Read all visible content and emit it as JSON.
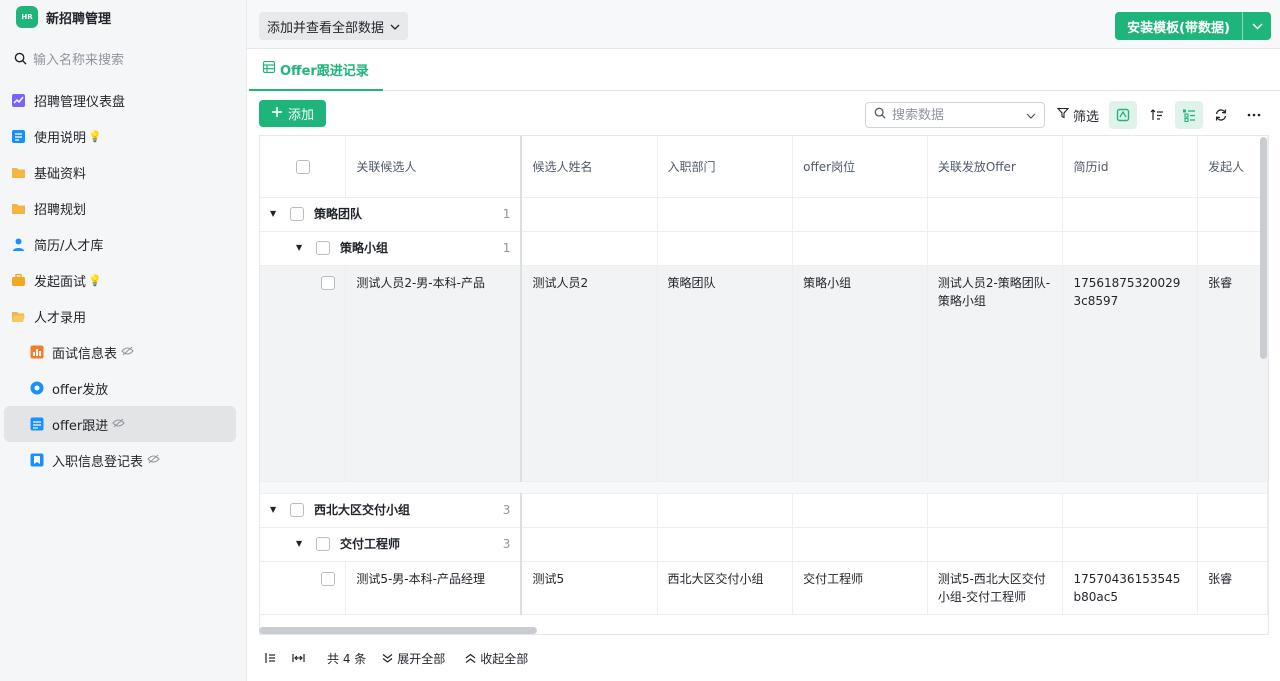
{
  "app": {
    "logo_text": "HR",
    "title": "新招聘管理"
  },
  "sidebar": {
    "search_placeholder": "输入名称来搜索",
    "items": [
      {
        "label": "招聘管理仪表盘",
        "icon": "dashboard-icon"
      },
      {
        "label": "使用说明",
        "icon": "doc-icon",
        "hint": "💡"
      },
      {
        "label": "基础资料",
        "icon": "folder-icon"
      },
      {
        "label": "招聘规划",
        "icon": "folder-icon"
      },
      {
        "label": "简历/人才库",
        "icon": "person-icon"
      },
      {
        "label": "发起面试",
        "icon": "briefcase-icon",
        "hint": "💡"
      },
      {
        "label": "人才录用",
        "icon": "folder-open-icon"
      },
      {
        "label": "面试信息表",
        "icon": "chart-icon",
        "hidden": true
      },
      {
        "label": "offer发放",
        "icon": "flow-icon"
      },
      {
        "label": "offer跟进",
        "icon": "table-icon",
        "hidden": true,
        "active": true
      },
      {
        "label": "入职信息登记表",
        "icon": "bookmark-icon",
        "hidden": true
      }
    ]
  },
  "topbar": {
    "view_all_label": "添加并查看全部数据",
    "install_label": "安装模板(带数据)"
  },
  "tab": {
    "label": "Offer跟进记录"
  },
  "toolbar": {
    "add_label": "添加",
    "search_placeholder": "搜索数据",
    "filter_label": "筛选"
  },
  "table": {
    "columns": [
      "关联候选人",
      "候选人姓名",
      "入职部门",
      "offer岗位",
      "关联发放Offer",
      "简历id",
      "发起人"
    ],
    "groups": [
      {
        "name": "策略团队",
        "count": "1",
        "subgroups": [
          {
            "name": "策略小组",
            "count": "1",
            "rows": [
              {
                "candidate": "测试人员2-男-本科-产品",
                "name": "测试人员2",
                "dept": "策略团队",
                "position": "策略小组",
                "offer": "测试人员2-策略团队-策略小组",
                "resume_id": "175618753200293c8597",
                "initiator": "张睿"
              }
            ]
          }
        ]
      },
      {
        "name": "西北大区交付小组",
        "count": "3",
        "subgroups": [
          {
            "name": "交付工程师",
            "count": "3",
            "rows": [
              {
                "candidate": "测试5-男-本科-产品经理",
                "name": "测试5",
                "dept": "西北大区交付小组",
                "position": "交付工程师",
                "offer": "测试5-西北大区交付小组-交付工程师",
                "resume_id": "17570436153545b80ac5",
                "initiator": "张睿"
              }
            ]
          }
        ]
      }
    ]
  },
  "footer": {
    "total_label": "共 4 条",
    "expand_label": "展开全部",
    "collapse_label": "收起全部"
  },
  "colors": {
    "accent": "#1fb47a"
  }
}
